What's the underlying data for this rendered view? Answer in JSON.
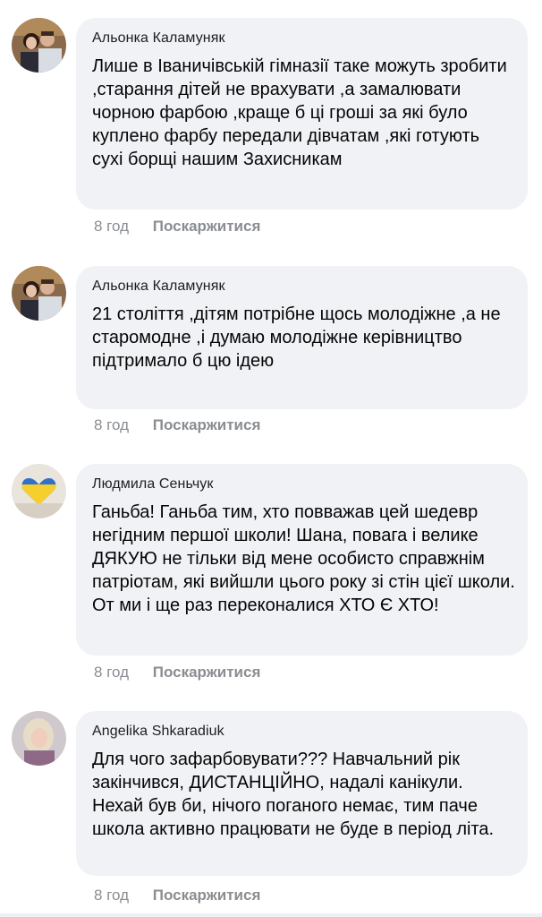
{
  "comments": [
    {
      "author": "Альонка Каламуняк",
      "text": "Лише в Іваничівській гімназії таке можуть зробити ,старання дітей не врахувати ,а замалювати чорною фарбою ,краще б ці гроші за які було куплено фарбу передали дівчатам ,які готують сухі борщі нашим Захисникам",
      "time": "8 год",
      "report": "Поскаржитися",
      "avatar": "couple-photo-avatar"
    },
    {
      "author": "Альонка Каламуняк",
      "text": "21 століття ,дітям потрібне щось молодіжне ,а не старомодне ,і думаю молодіжне керівництво підтримало б цю ідею",
      "time": "8 год",
      "report": "Поскаржитися",
      "avatar": "couple-photo-avatar"
    },
    {
      "author": "Людмила Сеньчук",
      "text": "Ганьба! Ганьба тим, хто повважав цей шедевр негідним першої школи! Шана, повага і велике ДЯКУЮ не тільки від мене особисто справжнім патріотам, які вийшли цього року зі стін цієї школи. От ми і ще раз переконалися ХТО Є ХТО!",
      "time": "8 год",
      "report": "Поскаржитися",
      "avatar": "ukraine-heart-avatar"
    },
    {
      "author": "Angelika Shkaradiuk",
      "text": "Для чого зафарбовувати??? Навчальний рік закінчився, ДИСТАНЦІЙНО, надалі канікули. Нехай був би, нічого поганого немає, тим паче школа активно працювати не буде в період літа.",
      "time": "8 год",
      "report": "Поскаржитися",
      "avatar": "woman-photo-avatar"
    }
  ]
}
